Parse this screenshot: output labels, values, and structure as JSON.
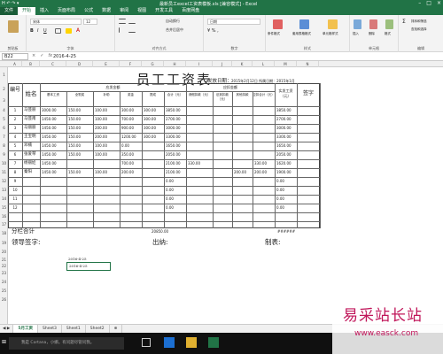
{
  "window": {
    "title": "最新员工excel工资表模板.xls [兼容模式] - Excel",
    "quick_access": "H ↶ ↷ ▾"
  },
  "tabs": [
    "文件",
    "开始",
    "插入",
    "页面布局",
    "公式",
    "数据",
    "审阅",
    "视图",
    "开发工具",
    "百度网盘"
  ],
  "ribbon": {
    "clipboard": "剪贴板",
    "font": "字体",
    "alignment": "对齐方式",
    "number": "数字",
    "styles": "样式",
    "cells": "单元格",
    "editing": "编辑",
    "font_name": "宋体",
    "font_size": "12",
    "number_format": "日期",
    "wrap": "自动换行",
    "merge": "合并后居中",
    "cond_format": "条件格式",
    "table_format": "套用表格格式",
    "cell_style": "单元格样式",
    "insert": "插入",
    "delete": "删除",
    "format": "格式",
    "sort_filter": "排序和筛选",
    "find": "查找和选择"
  },
  "formula_bar": {
    "name_box": "B22",
    "fx": "fx",
    "value": "2016-4-25"
  },
  "columns": [
    "A",
    "B",
    "C",
    "D",
    "E",
    "F",
    "G",
    "H",
    "I",
    "J",
    "K",
    "L",
    "M",
    "N"
  ],
  "rows": [
    "1",
    "2",
    "3",
    "4",
    "5",
    "6",
    "7",
    "8",
    "9",
    "10",
    "11",
    "12",
    "13",
    "14",
    "15",
    "16",
    "17",
    "18",
    "19",
    "20",
    "21",
    "22",
    "23",
    "24",
    "25",
    "26"
  ],
  "sheet": {
    "title": "员工工资表",
    "issue_date_label": "发放日期：",
    "issue_date": "2015年2月12日 所属日期：2015年1月",
    "h_no": "编号",
    "h_name": "姓名",
    "h_payable": "应发金额",
    "h_deduct": "应扣金额",
    "h_actual": "实发工资（元）",
    "h_sign": "签字",
    "sub": [
      "基本工资",
      "全勤奖",
      "补助",
      "奖金",
      "提成",
      "合计（元）",
      "请假扣款（元）",
      "迟到扣款（元）",
      "其他扣款",
      "应扣合计（元）"
    ],
    "rows": [
      {
        "no": "1",
        "name": "马芸丽",
        "v": [
          "3000.00",
          "150.00",
          "100.00",
          "300.00",
          "300.00",
          "3850.00",
          "",
          "",
          "",
          "",
          "3850.00"
        ]
      },
      {
        "no": "2",
        "name": "马芸南",
        "v": [
          "1450.00",
          "150.00",
          "100.00",
          "700.00",
          "300.00",
          "2700.00",
          "",
          "",
          "",
          "",
          "2700.00"
        ]
      },
      {
        "no": "3",
        "name": "马丽丽",
        "v": [
          "1450.00",
          "150.00",
          "200.00",
          "900.00",
          "300.00",
          "3000.00",
          "",
          "",
          "",
          "",
          "3000.00"
        ]
      },
      {
        "no": "4",
        "name": "王宝明",
        "v": [
          "1450.00",
          "150.00",
          "200.00",
          "1200.00",
          "300.00",
          "3300.00",
          "",
          "",
          "",
          "",
          "3300.00"
        ]
      },
      {
        "no": "5",
        "name": "邓楠",
        "v": [
          "1450.00",
          "150.00",
          "100.00",
          "0.00",
          "",
          "1650.00",
          "",
          "",
          "",
          "",
          "1650.00"
        ]
      },
      {
        "no": "6",
        "name": "张爱琴",
        "v": [
          "1450.00",
          "150.00",
          "100.00",
          "350.00",
          "",
          "2050.00",
          "",
          "",
          "",
          "",
          "2050.00"
        ]
      },
      {
        "no": "7",
        "name": "杨丽娃",
        "v": [
          "1450.00",
          "",
          "",
          "700.00",
          "",
          "2100.00",
          "330.00",
          "",
          "",
          "330.00",
          "1620.00"
        ]
      },
      {
        "no": "8",
        "name": "秦阳",
        "v": [
          "1450.00",
          "150.00",
          "100.00",
          "200.00",
          "",
          "2100.00",
          "",
          "",
          "200.00",
          "200.00",
          "1900.00"
        ]
      },
      {
        "no": "9",
        "name": "",
        "v": [
          "",
          "",
          "",
          "",
          "",
          "0.00",
          "",
          "",
          "",
          "",
          "0.00"
        ]
      },
      {
        "no": "10",
        "name": "",
        "v": [
          "",
          "",
          "",
          "",
          "",
          "0.00",
          "",
          "",
          "",
          "",
          "0.00"
        ]
      },
      {
        "no": "11",
        "name": "",
        "v": [
          "",
          "",
          "",
          "",
          "",
          "0.00",
          "",
          "",
          "",
          "",
          "0.00"
        ]
      },
      {
        "no": "12",
        "name": "",
        "v": [
          "",
          "",
          "",
          "",
          "",
          "0.00",
          "",
          "",
          "",
          "",
          "0.00"
        ]
      }
    ],
    "subtotal_label": "分栏合计",
    "subtotal_value": "20850.00",
    "subtotal_hash": "######",
    "sig_leader": "领导签字:",
    "sig_cashier": "出纳:",
    "sig_maker": "制表:",
    "date1": "2016-4-25",
    "date2": "2016-4-25"
  },
  "sheet_tabs": [
    "5月工资",
    "Sheet3",
    "Sheet1",
    "Sheet2"
  ],
  "taskbar": {
    "search": "我是 Cortana，小娜。有问题尽管问我。"
  },
  "watermark": {
    "cn": "易采站长站",
    "url": "www.easck.com"
  }
}
